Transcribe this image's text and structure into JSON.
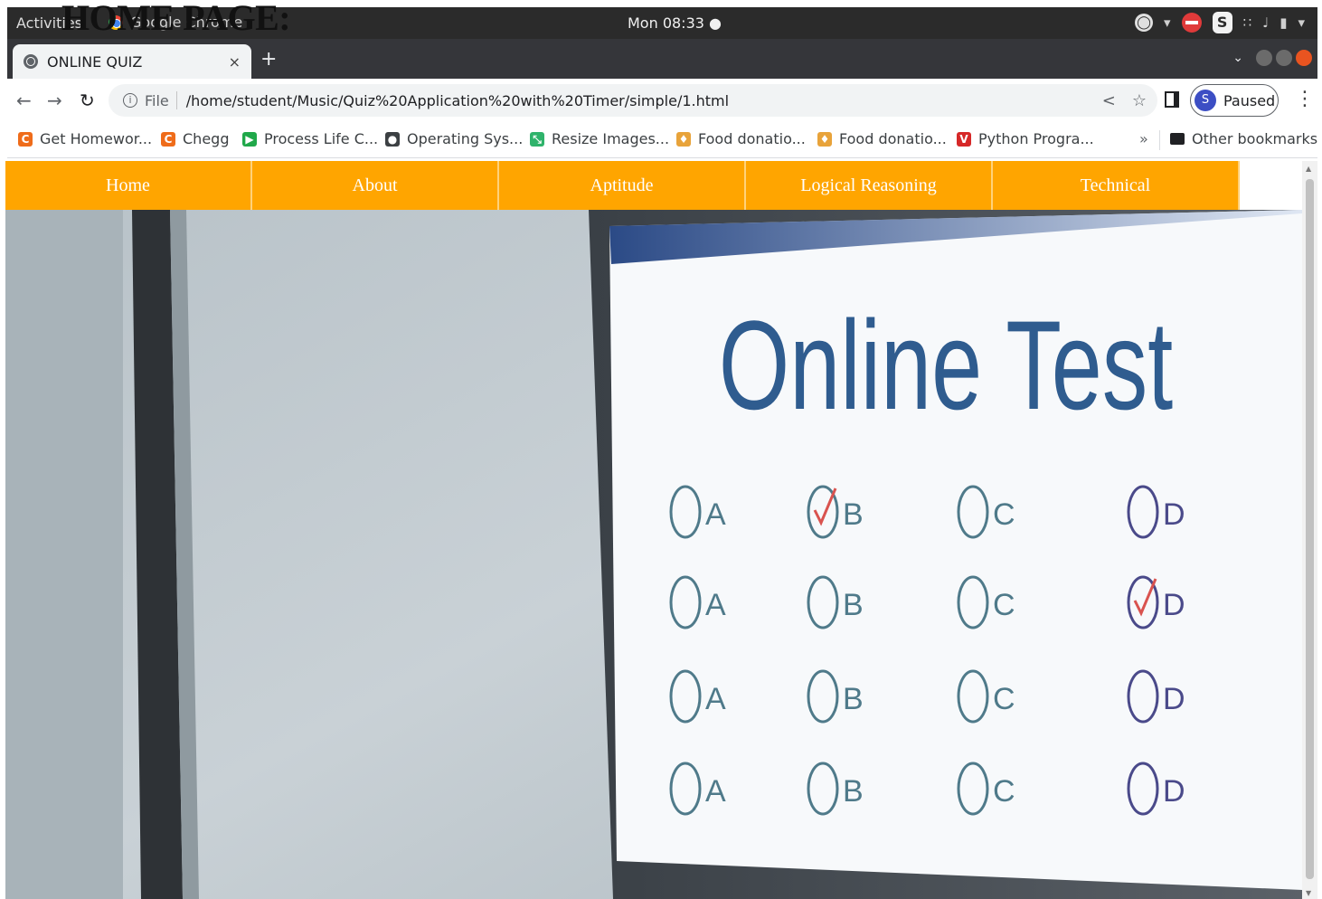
{
  "document_heading": "HOME PAGE:",
  "system_bar": {
    "activities": "Activities",
    "app_name": "Google Chrome",
    "clock": "Mon 08:33 ●"
  },
  "browser": {
    "tab_title": "ONLINE QUIZ",
    "tab_close": "×",
    "new_tab": "+",
    "url_scheme": "File",
    "url": "/home/student/Music/Quiz%20Application%20with%20Timer/simple/1.html",
    "profile_initial": "S",
    "profile_status": "Paused",
    "bookmarks": [
      {
        "label": "Get Homewor...",
        "icon": "chegg-icon",
        "color": "#ef6c1a"
      },
      {
        "label": "Chegg",
        "icon": "chegg-icon",
        "color": "#ef6c1a"
      },
      {
        "label": "Process Life C...",
        "icon": "play-icon",
        "color": "#20a84a"
      },
      {
        "label": "Operating Sys...",
        "icon": "globe-icon",
        "color": "#3c4043"
      },
      {
        "label": "Resize Images...",
        "icon": "resize-icon",
        "color": "#2fb36b"
      },
      {
        "label": "Food donatio...",
        "icon": "food-icon",
        "color": "#e8a33a"
      },
      {
        "label": "Food donatio...",
        "icon": "food-icon",
        "color": "#e8a33a"
      },
      {
        "label": "Python Progra...",
        "icon": "v-icon",
        "color": "#d62828"
      }
    ],
    "bookmarks_more": "»",
    "other_bookmarks": "Other bookmarks"
  },
  "page": {
    "nav": [
      "Home",
      "About",
      "Aptitude",
      "Logical Reasoning",
      "Technical"
    ],
    "nav_color": "#ffa500",
    "hero": {
      "title": "Online Test",
      "options": [
        "A",
        "B",
        "C",
        "D"
      ],
      "checked": [
        [
          0,
          1
        ],
        [
          1,
          3
        ]
      ]
    }
  }
}
